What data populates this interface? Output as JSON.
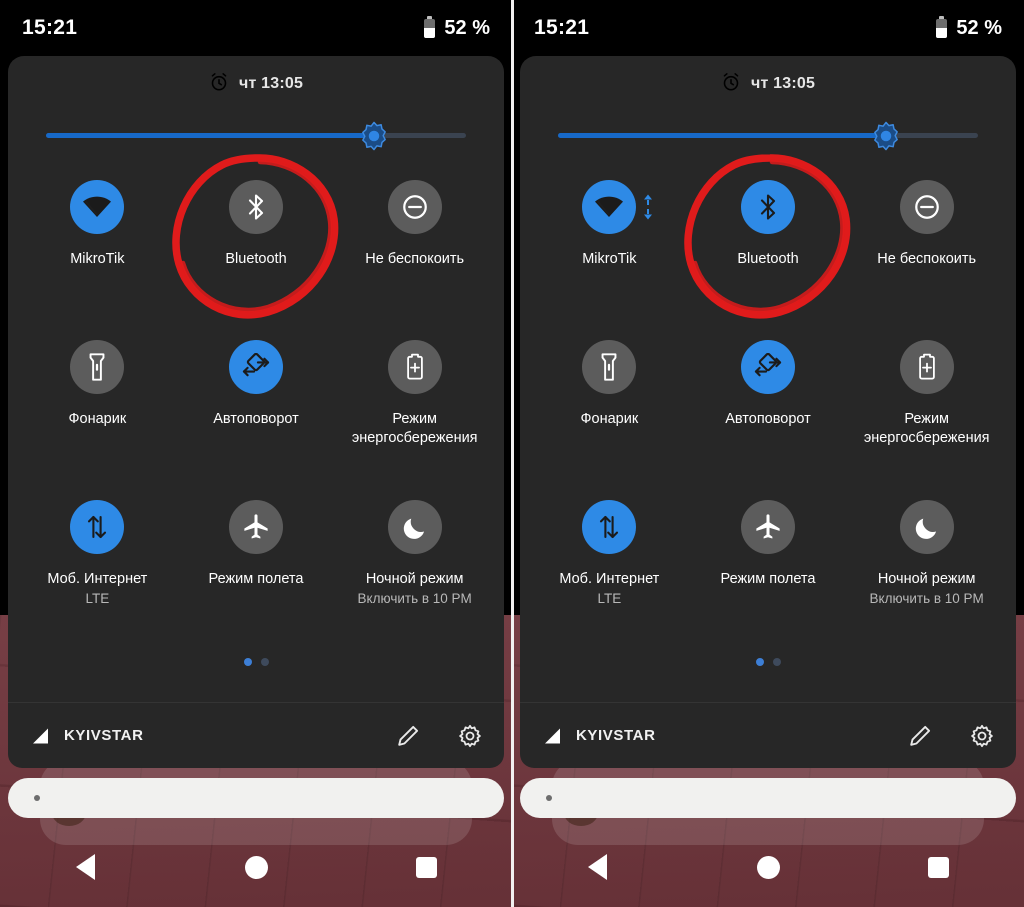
{
  "meta": {
    "description": "Android quick settings panel, before/after Bluetooth toggle",
    "accent_blue": "#2e8ae6",
    "inactive_gray": "#5c5c5c",
    "panel_bg": "#272727",
    "annotation_red": "#e01b1b",
    "wallpaper": "#6e3239"
  },
  "statusbar": {
    "clock": "15:21",
    "battery_text": "52 %",
    "battery_icon": "battery-icon"
  },
  "alarm": {
    "icon": "alarm-clock-icon",
    "text": "чт 13:05"
  },
  "brightness": {
    "icon": "brightness-sun-icon",
    "percent": 78
  },
  "panels": [
    {
      "id": "before",
      "rows": [
        [
          {
            "name": "wifi",
            "icon": "wifi-icon",
            "label": "MikroTik",
            "sub": "",
            "active": true,
            "data_arrows": false
          },
          {
            "name": "bluetooth",
            "icon": "bluetooth-icon",
            "label": "Bluetooth",
            "sub": "",
            "active": false,
            "data_arrows": false
          },
          {
            "name": "do-not-disturb",
            "icon": "do-not-disturb-icon",
            "label": "Не беспокоить",
            "sub": "",
            "active": false,
            "data_arrows": false
          }
        ],
        [
          {
            "name": "flashlight",
            "icon": "flashlight-icon",
            "label": "Фонарик",
            "sub": "",
            "active": false,
            "data_arrows": false
          },
          {
            "name": "auto-rotate",
            "icon": "auto-rotate-icon",
            "label": "Автоповорот",
            "sub": "",
            "active": true,
            "data_arrows": false
          },
          {
            "name": "battery-saver",
            "icon": "battery-saver-icon",
            "label": "Режим энергосбережения",
            "sub": "",
            "active": false,
            "data_arrows": false
          }
        ],
        [
          {
            "name": "mobile-data",
            "icon": "mobile-data-icon",
            "label": "Моб. Интернет",
            "sub": "LTE",
            "active": true,
            "data_arrows": false
          },
          {
            "name": "airplane-mode",
            "icon": "airplane-icon",
            "label": "Режим полета",
            "sub": "",
            "active": false,
            "data_arrows": false
          },
          {
            "name": "night-mode",
            "icon": "moon-icon",
            "label": "Ночной режим",
            "sub": "Включить в 10 PM",
            "active": false,
            "data_arrows": false
          }
        ]
      ]
    },
    {
      "id": "after",
      "rows": [
        [
          {
            "name": "wifi",
            "icon": "wifi-icon",
            "label": "MikroTik",
            "sub": "",
            "active": true,
            "data_arrows": true
          },
          {
            "name": "bluetooth",
            "icon": "bluetooth-icon",
            "label": "Bluetooth",
            "sub": "",
            "active": true,
            "data_arrows": false
          },
          {
            "name": "do-not-disturb",
            "icon": "do-not-disturb-icon",
            "label": "Не беспокоить",
            "sub": "",
            "active": false,
            "data_arrows": false
          }
        ],
        [
          {
            "name": "flashlight",
            "icon": "flashlight-icon",
            "label": "Фонарик",
            "sub": "",
            "active": false,
            "data_arrows": false
          },
          {
            "name": "auto-rotate",
            "icon": "auto-rotate-icon",
            "label": "Автоповорот",
            "sub": "",
            "active": true,
            "data_arrows": false
          },
          {
            "name": "battery-saver",
            "icon": "battery-saver-icon",
            "label": "Режим энергосбережения",
            "sub": "",
            "active": false,
            "data_arrows": false
          }
        ],
        [
          {
            "name": "mobile-data",
            "icon": "mobile-data-icon",
            "label": "Моб. Интернет",
            "sub": "LTE",
            "active": true,
            "data_arrows": false
          },
          {
            "name": "airplane-mode",
            "icon": "airplane-icon",
            "label": "Режим полета",
            "sub": "",
            "active": false,
            "data_arrows": false
          },
          {
            "name": "night-mode",
            "icon": "moon-icon",
            "label": "Ночной режим",
            "sub": "Включить в 10 PM",
            "active": false,
            "data_arrows": false
          }
        ]
      ]
    }
  ],
  "pager": {
    "count": 2,
    "active_index": 0
  },
  "footer": {
    "carrier_icon": "signal-strength-icon",
    "carrier": "KYIVSTAR",
    "edit_icon": "pencil-icon",
    "settings_icon": "gear-icon"
  },
  "search": {
    "placeholder": ""
  },
  "navbar": {
    "back": "back-triangle-icon",
    "home": "home-circle-icon",
    "recents": "recents-square-icon"
  },
  "annotation": {
    "shape": "hand-drawn-circle",
    "targets": [
      "bluetooth",
      "bluetooth"
    ]
  }
}
